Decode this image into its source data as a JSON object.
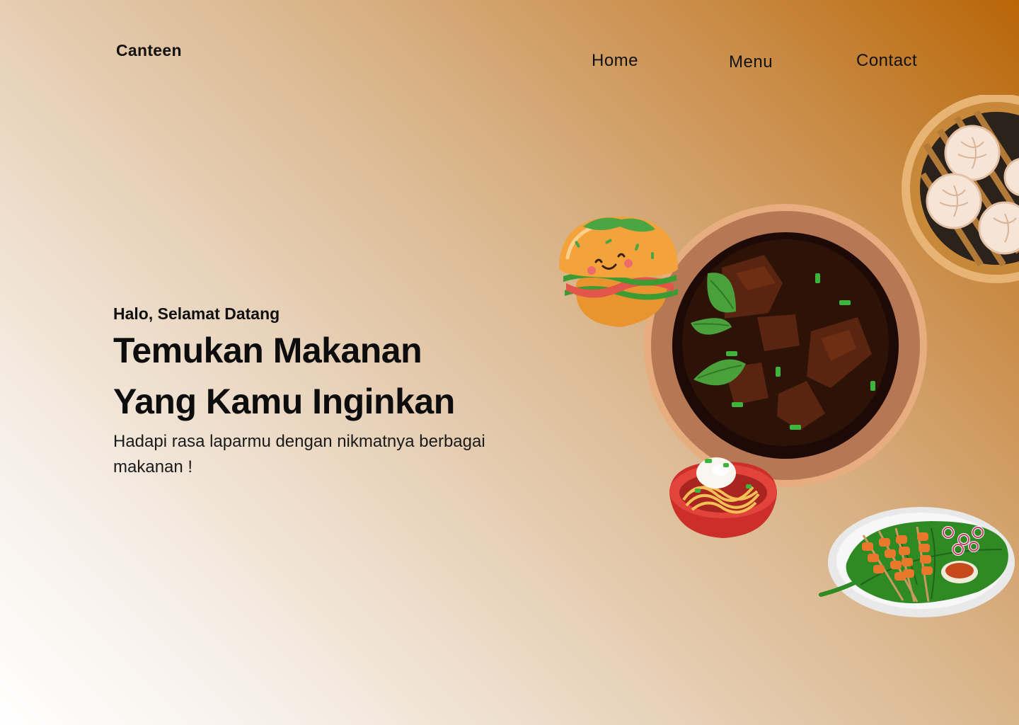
{
  "brand": {
    "name": "Canteen"
  },
  "nav": {
    "items": [
      {
        "label": "Home"
      },
      {
        "label": "Menu"
      },
      {
        "label": "Contact"
      }
    ]
  },
  "hero": {
    "greeting": "Halo, Selamat Datang",
    "headline_line1": "Temukan Makanan",
    "headline_line2": "Yang Kamu Inginkan",
    "subtitle": "Hadapi rasa laparmu dengan nikmatnya berbagai makanan !"
  },
  "illustrations": [
    {
      "icon": "dumpling-steamer-icon"
    },
    {
      "icon": "burger-icon"
    },
    {
      "icon": "soup-bowl-icon"
    },
    {
      "icon": "noodle-bowl-icon"
    },
    {
      "icon": "satay-plate-icon"
    }
  ],
  "colors": {
    "gradient_dark": "#b86607",
    "gradient_light": "#ffffff",
    "text": "#111111"
  }
}
